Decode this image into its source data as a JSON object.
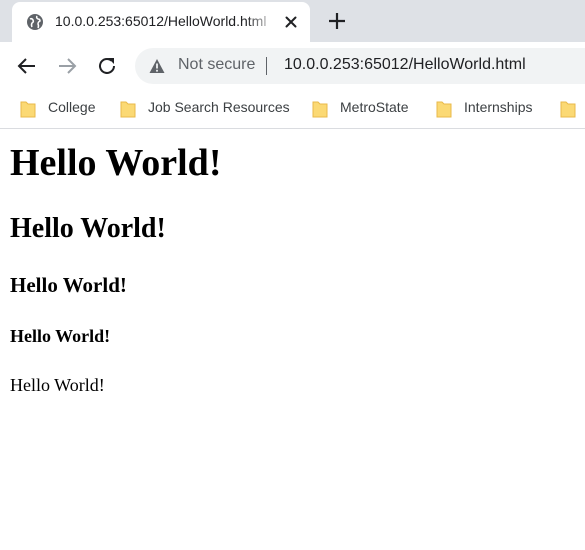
{
  "browser": {
    "tab": {
      "title": "10.0.0.253:65012/HelloWorld.html",
      "favicon_icon": "globe-icon",
      "close_icon": "close-icon"
    },
    "new_tab_icon": "plus-icon",
    "nav": {
      "back_icon": "arrow-left-icon",
      "forward_icon": "arrow-right-icon",
      "reload_icon": "reload-icon"
    },
    "omnibox": {
      "security_icon": "warning-triangle-icon",
      "security_text": "Not secure",
      "url": "10.0.0.253:65012/HelloWorld.html"
    },
    "bookmarks": [
      {
        "label": "College",
        "icon": "folder-icon"
      },
      {
        "label": "Job Search Resources",
        "icon": "folder-icon"
      },
      {
        "label": "MetroState",
        "icon": "folder-icon"
      },
      {
        "label": "Internships",
        "icon": "folder-icon"
      },
      {
        "label": "",
        "icon": "folder-icon"
      }
    ]
  },
  "page": {
    "h1": "Hello World!",
    "h2": "Hello World!",
    "h3": "Hello World!",
    "h4": "Hello World!",
    "p": "Hello World!"
  },
  "colors": {
    "tabstrip": "#dee1e6",
    "omnibox": "#f1f3f4",
    "folder": "#fbd974",
    "folder_outline": "#e8b94a",
    "icon": "#5f6368",
    "forward_disabled": "#9aa0a6"
  }
}
